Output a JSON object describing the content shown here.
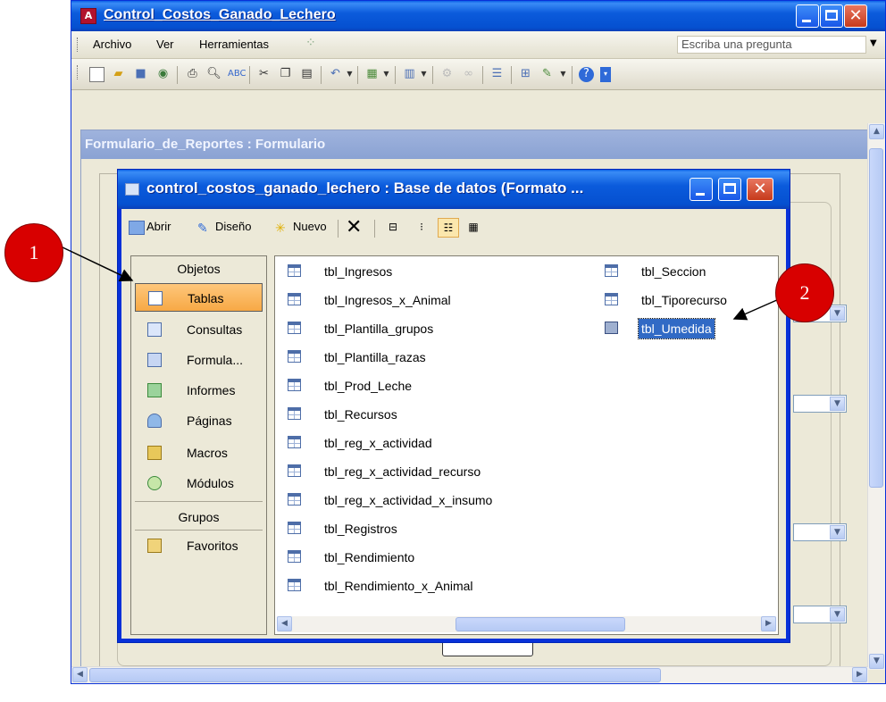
{
  "app": {
    "title": "Control_Costos_Ganado_Lechero",
    "menu": [
      "Archivo",
      "Ver",
      "Herramientas"
    ],
    "help_placeholder": "Escriba una pregunta"
  },
  "form_window": {
    "title": "Formulario_de_Reportes : Formulario"
  },
  "db_window": {
    "title": "control_costos_ganado_lechero : Base de datos (Formato ...",
    "toolbar": {
      "open": "Abrir",
      "design": "Diseño",
      "new": "Nuevo"
    },
    "objects_header": "Objetos",
    "objects": [
      {
        "label": "Tablas",
        "icon": "table-icon",
        "selected": true
      },
      {
        "label": "Consultas",
        "icon": "query-icon",
        "selected": false
      },
      {
        "label": "Formula...",
        "icon": "form-icon",
        "selected": false
      },
      {
        "label": "Informes",
        "icon": "report-icon",
        "selected": false
      },
      {
        "label": "Páginas",
        "icon": "page-icon",
        "selected": false
      },
      {
        "label": "Macros",
        "icon": "macro-icon",
        "selected": false
      },
      {
        "label": "Módulos",
        "icon": "module-icon",
        "selected": false
      }
    ],
    "groups_header": "Grupos",
    "groups": [
      {
        "label": "Favoritos",
        "icon": "favorites-folder-icon"
      }
    ],
    "tables_col1": [
      "tbl_Ingresos",
      "tbl_Ingresos_x_Animal",
      "tbl_Plantilla_grupos",
      "tbl_Plantilla_razas",
      "tbl_Prod_Leche",
      "tbl_Recursos",
      "tbl_reg_x_actividad",
      "tbl_reg_x_actividad_recurso",
      "tbl_reg_x_actividad_x_insumo",
      "tbl_Registros",
      "tbl_Rendimiento",
      "tbl_Rendimiento_x_Animal"
    ],
    "tables_col2": [
      {
        "label": "tbl_Seccion",
        "selected": false
      },
      {
        "label": "tbl_Tiporecurso",
        "selected": false
      },
      {
        "label": "tbl_Umedida",
        "selected": true
      }
    ]
  },
  "callouts": {
    "one": "1",
    "two": "2"
  },
  "colors": {
    "xp_blue": "#0b5bdc",
    "selection_orange": "#f7a945",
    "selection_blue": "#316ac5",
    "callout_red": "#d80000"
  }
}
